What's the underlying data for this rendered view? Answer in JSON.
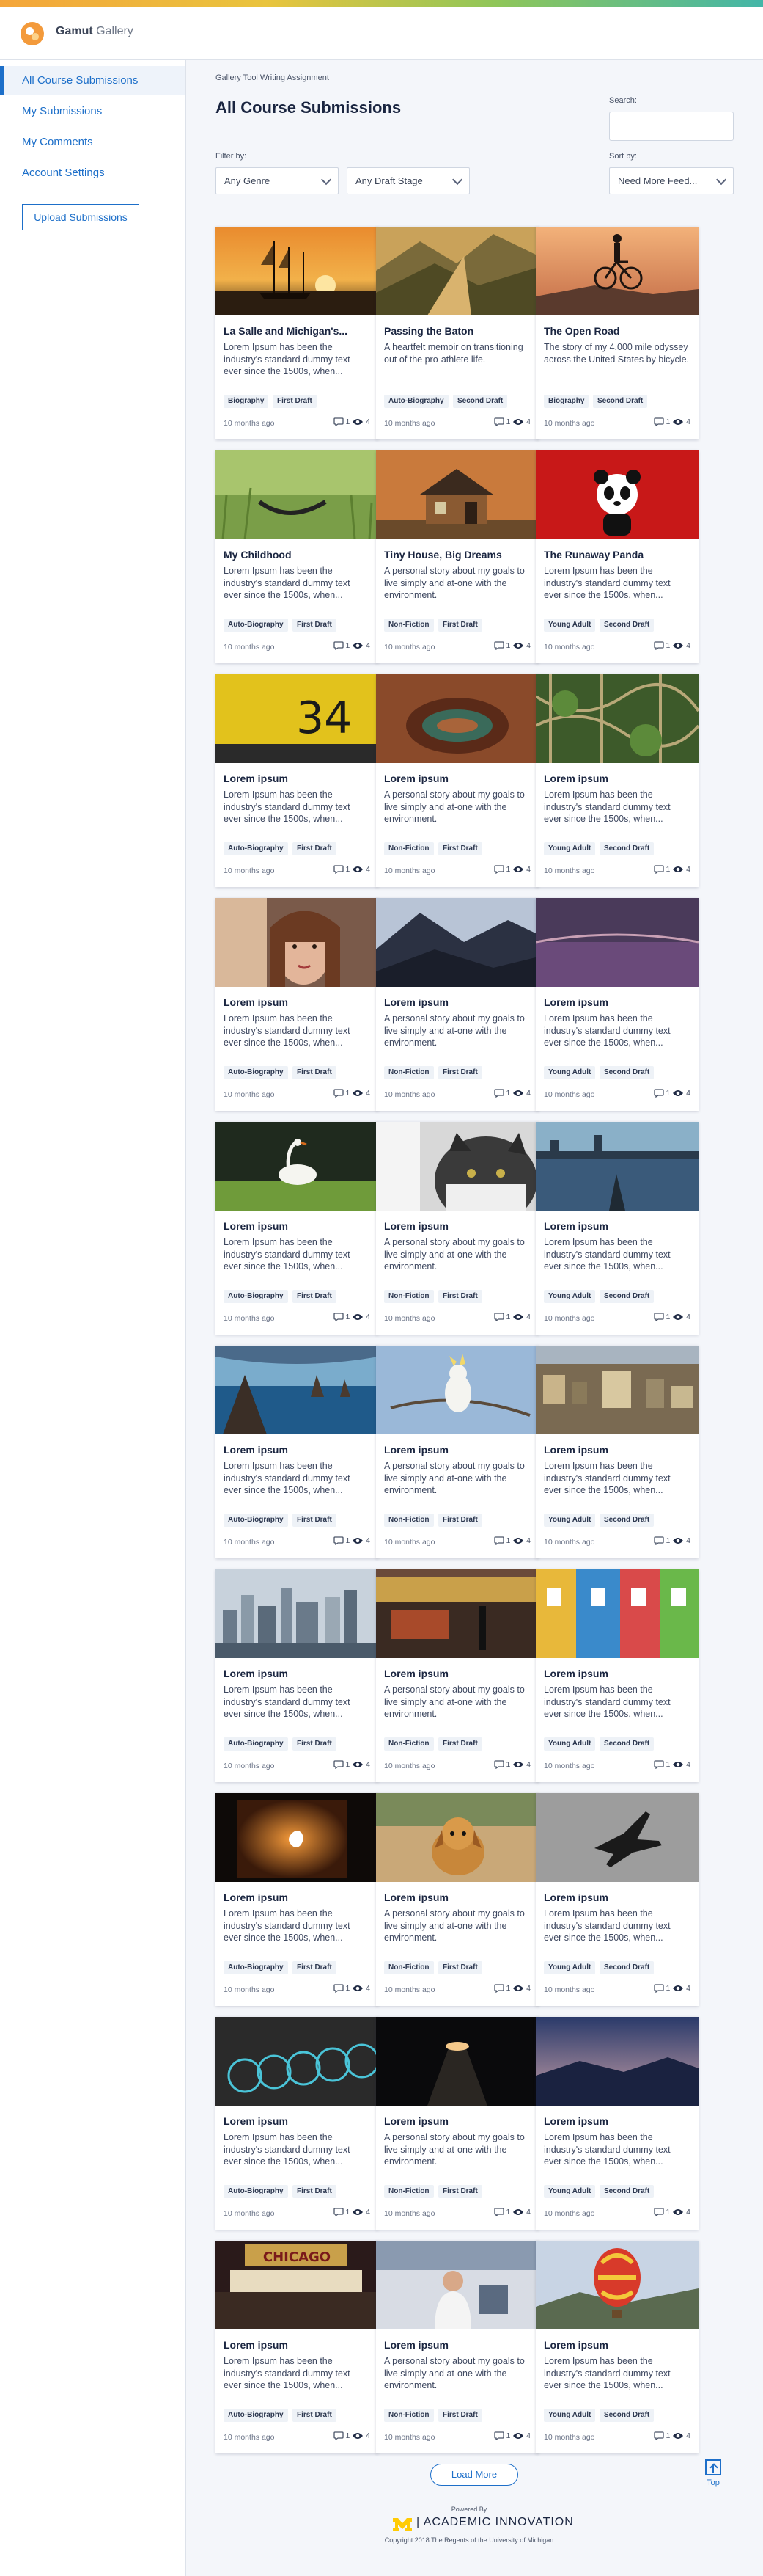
{
  "brand": {
    "bold": "Gamut",
    "light": "Gallery"
  },
  "sidebar": {
    "items": [
      {
        "label": "All Course Submissions",
        "active": true
      },
      {
        "label": "My Submissions",
        "active": false
      },
      {
        "label": "My Comments",
        "active": false
      },
      {
        "label": "Account Settings",
        "active": false
      }
    ],
    "upload_label": "Upload Submissions"
  },
  "main": {
    "kicker": "Gallery Tool Writing Assignment",
    "title": "All Course Submissions",
    "search_label": "Search:",
    "filter_label": "Filter by:",
    "sort_label": "Sort by:",
    "genre_select": "Any Genre",
    "stage_select": "Any Draft Stage",
    "sort_select": "Need More Feed..."
  },
  "cards": [
    {
      "title": "La Salle and Michigan's...",
      "desc": "Lorem Ipsum has been the industry's standard dummy text ever since the 1500s, when...",
      "tags": [
        "Biography",
        "First Draft"
      ],
      "time": "10 months ago",
      "comments": "1",
      "views": "4",
      "image": "sunset-ship"
    },
    {
      "title": "Passing the Baton",
      "desc": "A heartfelt memoir on transitioning out of the pro-athlete life.",
      "tags": [
        "Auto-Biography",
        "Second Draft"
      ],
      "time": "10 months ago",
      "comments": "1",
      "views": "4",
      "image": "mountain-ridge"
    },
    {
      "title": "The Open Road",
      "desc": "The story of my 4,000 mile odyssey across the United States by bicycle.",
      "tags": [
        "Biography",
        "Second Draft"
      ],
      "time": "10 months ago",
      "comments": "1",
      "views": "4",
      "image": "cyclist-sunset"
    },
    {
      "title": "My Childhood",
      "desc": "Lorem Ipsum has been the industry's standard dummy text ever since the 1500s, when...",
      "tags": [
        "Auto-Biography",
        "First Draft"
      ],
      "time": "10 months ago",
      "comments": "1",
      "views": "4",
      "image": "grass-swing"
    },
    {
      "title": "Tiny House, Big Dreams",
      "desc": "A personal story about my goals to live simply and at-one with the environment.",
      "tags": [
        "Non-Fiction",
        "First Draft"
      ],
      "time": "10 months ago",
      "comments": "1",
      "views": "4",
      "image": "tiny-house"
    },
    {
      "title": "The Runaway Panda",
      "desc": "Lorem Ipsum has been the industry's standard dummy text ever since the 1500s, when...",
      "tags": [
        "Young Adult",
        "Second Draft"
      ],
      "time": "10 months ago",
      "comments": "1",
      "views": "4",
      "image": "panda-red"
    },
    {
      "title": "Lorem ipsum",
      "desc": "Lorem Ipsum has been the industry's standard dummy text ever since the 1500s, when...",
      "tags": [
        "Auto-Biography",
        "First Draft"
      ],
      "time": "10 months ago",
      "comments": "1",
      "views": "4",
      "image": "yellow-34"
    },
    {
      "title": "Lorem ipsum",
      "desc": "A personal story about my goals to live simply and at-one with the environment.",
      "tags": [
        "Non-Fiction",
        "First Draft"
      ],
      "time": "10 months ago",
      "comments": "1",
      "views": "4",
      "image": "canyon-bend"
    },
    {
      "title": "Lorem ipsum",
      "desc": "Lorem Ipsum has been the industry's standard dummy text ever since the 1500s, when...",
      "tags": [
        "Young Adult",
        "Second Draft"
      ],
      "time": "10 months ago",
      "comments": "1",
      "views": "4",
      "image": "forest-vines"
    },
    {
      "title": "Lorem ipsum",
      "desc": "Lorem Ipsum has been the industry's standard dummy text ever since the 1500s, when...",
      "tags": [
        "Auto-Biography",
        "First Draft"
      ],
      "time": "10 months ago",
      "comments": "1",
      "views": "4",
      "image": "portrait-woman"
    },
    {
      "title": "Lorem ipsum",
      "desc": "A personal story about my goals to live simply and at-one with the environment.",
      "tags": [
        "Non-Fiction",
        "First Draft"
      ],
      "time": "10 months ago",
      "comments": "1",
      "views": "4",
      "image": "misty-mountains"
    },
    {
      "title": "Lorem ipsum",
      "desc": "Lorem Ipsum has been the industry's standard dummy text ever since the 1500s, when...",
      "tags": [
        "Young Adult",
        "Second Draft"
      ],
      "time": "10 months ago",
      "comments": "1",
      "views": "4",
      "image": "purple-field"
    },
    {
      "title": "Lorem ipsum",
      "desc": "Lorem Ipsum has been the industry's standard dummy text ever since the 1500s, when...",
      "tags": [
        "Auto-Biography",
        "First Draft"
      ],
      "time": "10 months ago",
      "comments": "1",
      "views": "4",
      "image": "swan-grass"
    },
    {
      "title": "Lorem ipsum",
      "desc": "A personal story about my goals to live simply and at-one with the environment.",
      "tags": [
        "Non-Fiction",
        "First Draft"
      ],
      "time": "10 months ago",
      "comments": "1",
      "views": "4",
      "image": "cat-closeup"
    },
    {
      "title": "Lorem ipsum",
      "desc": "Lorem Ipsum has been the industry's standard dummy text ever since the 1500s, when...",
      "tags": [
        "Young Adult",
        "Second Draft"
      ],
      "time": "10 months ago",
      "comments": "1",
      "views": "4",
      "image": "city-water"
    },
    {
      "title": "Lorem ipsum",
      "desc": "Lorem Ipsum has been the industry's standard dummy text ever since the 1500s, when...",
      "tags": [
        "Auto-Biography",
        "First Draft"
      ],
      "time": "10 months ago",
      "comments": "1",
      "views": "4",
      "image": "sea-rocks"
    },
    {
      "title": "Lorem ipsum",
      "desc": "A personal story about my goals to live simply and at-one with the environment.",
      "tags": [
        "Non-Fiction",
        "First Draft"
      ],
      "time": "10 months ago",
      "comments": "1",
      "views": "4",
      "image": "cockatoo"
    },
    {
      "title": "Lorem ipsum",
      "desc": "Lorem Ipsum has been the industry's standard dummy text ever since the 1500s, when...",
      "tags": [
        "Young Adult",
        "Second Draft"
      ],
      "time": "10 months ago",
      "comments": "1",
      "views": "4",
      "image": "city-aerial"
    },
    {
      "title": "Lorem ipsum",
      "desc": "Lorem Ipsum has been the industry's standard dummy text ever since the 1500s, when...",
      "tags": [
        "Auto-Biography",
        "First Draft"
      ],
      "time": "10 months ago",
      "comments": "1",
      "views": "4",
      "image": "skyline"
    },
    {
      "title": "Lorem ipsum",
      "desc": "A personal story about my goals to live simply and at-one with the environment.",
      "tags": [
        "Non-Fiction",
        "First Draft"
      ],
      "time": "10 months ago",
      "comments": "1",
      "views": "4",
      "image": "train-station"
    },
    {
      "title": "Lorem ipsum",
      "desc": "Lorem Ipsum has been the industry's standard dummy text ever since the 1500s, when...",
      "tags": [
        "Young Adult",
        "Second Draft"
      ],
      "time": "10 months ago",
      "comments": "1",
      "views": "4",
      "image": "colorful-houses"
    },
    {
      "title": "Lorem ipsum",
      "desc": "Lorem Ipsum has been the industry's standard dummy text ever since the 1500s, when...",
      "tags": [
        "Auto-Biography",
        "First Draft"
      ],
      "time": "10 months ago",
      "comments": "1",
      "views": "4",
      "image": "laptop-glow"
    },
    {
      "title": "Lorem ipsum",
      "desc": "A personal story about my goals to live simply and at-one with the environment.",
      "tags": [
        "Non-Fiction",
        "First Draft"
      ],
      "time": "10 months ago",
      "comments": "1",
      "views": "4",
      "image": "dog-field"
    },
    {
      "title": "Lorem ipsum",
      "desc": "Lorem Ipsum has been the industry's standard dummy text ever since the 1500s, when...",
      "tags": [
        "Young Adult",
        "Second Draft"
      ],
      "time": "10 months ago",
      "comments": "1",
      "views": "4",
      "image": "plane-sky"
    },
    {
      "title": "Lorem ipsum",
      "desc": "Lorem Ipsum has been the industry's standard dummy text ever since the 1500s, when...",
      "tags": [
        "Auto-Biography",
        "First Draft"
      ],
      "time": "10 months ago",
      "comments": "1",
      "views": "4",
      "image": "bikes-row"
    },
    {
      "title": "Lorem ipsum",
      "desc": "A personal story about my goals to live simply and at-one with the environment.",
      "tags": [
        "Non-Fiction",
        "First Draft"
      ],
      "time": "10 months ago",
      "comments": "1",
      "views": "4",
      "image": "dark-tunnel"
    },
    {
      "title": "Lorem ipsum",
      "desc": "Lorem Ipsum has been the industry's standard dummy text ever since the 1500s, when...",
      "tags": [
        "Young Adult",
        "Second Draft"
      ],
      "time": "10 months ago",
      "comments": "1",
      "views": "4",
      "image": "blue-dusk"
    },
    {
      "title": "Lorem ipsum",
      "desc": "Lorem Ipsum has been the industry's standard dummy text ever since the 1500s, when...",
      "tags": [
        "Auto-Biography",
        "First Draft"
      ],
      "time": "10 months ago",
      "comments": "1",
      "views": "4",
      "image": "chicago-theatre"
    },
    {
      "title": "Lorem ipsum",
      "desc": "A personal story about my goals to live simply and at-one with the environment.",
      "tags": [
        "Non-Fiction",
        "First Draft"
      ],
      "time": "10 months ago",
      "comments": "1",
      "views": "4",
      "image": "lab-scientist"
    },
    {
      "title": "Lorem ipsum",
      "desc": "Lorem Ipsum has been the industry's standard dummy text ever since the 1500s, when...",
      "tags": [
        "Young Adult",
        "Second Draft"
      ],
      "time": "10 months ago",
      "comments": "1",
      "views": "4",
      "image": "hot-air-balloon"
    }
  ],
  "footer": {
    "load_more": "Load More",
    "top": "Top",
    "powered_by": "Powered By",
    "org": "ACADEMIC INNOVATION",
    "copyright": "Copyright   2018   The Regents of the University of Michigan"
  },
  "colors": {
    "accent": "#1d6fc9",
    "logo": "#f39a3b",
    "michigan_maize": "#ffcb05"
  }
}
